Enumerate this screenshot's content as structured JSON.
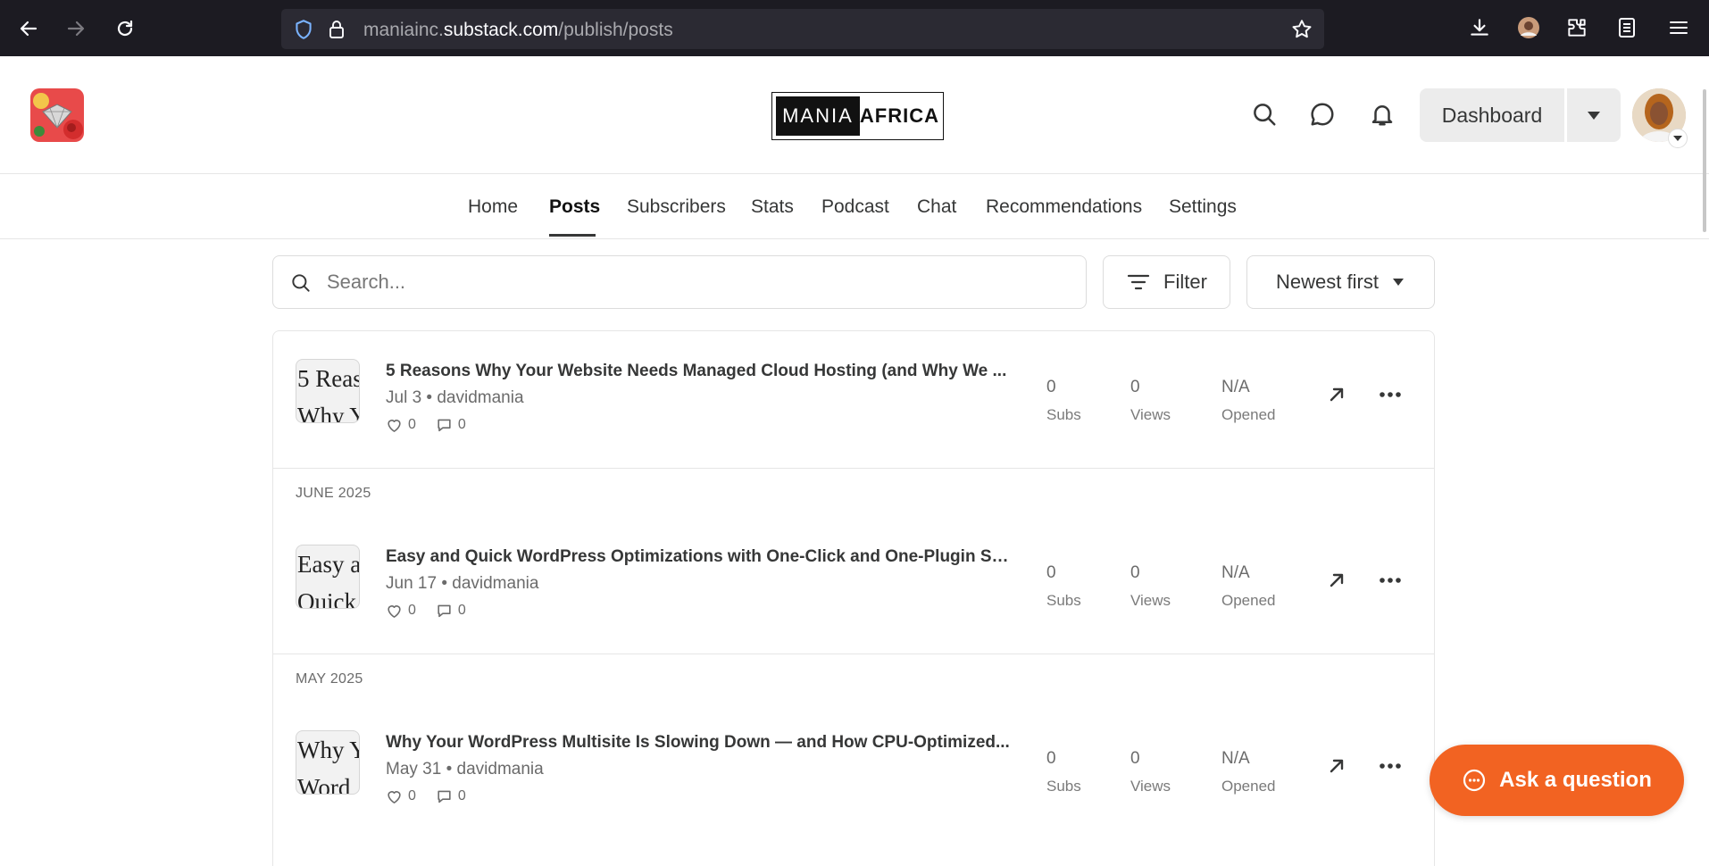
{
  "browser": {
    "url_prefix": "maniainc.",
    "url_host": "substack.com",
    "url_path": "/publish/posts"
  },
  "header": {
    "wordmark_left": "MANIA",
    "wordmark_right": "AFRICA",
    "dashboard_label": "Dashboard"
  },
  "tabs": [
    {
      "label": "Home"
    },
    {
      "label": "Posts"
    },
    {
      "label": "Subscribers"
    },
    {
      "label": "Stats"
    },
    {
      "label": "Podcast"
    },
    {
      "label": "Chat"
    },
    {
      "label": "Recommendations"
    },
    {
      "label": "Settings"
    }
  ],
  "toolbar": {
    "search_placeholder": "Search...",
    "filter_label": "Filter",
    "sort_label": "Newest first"
  },
  "posts": [
    {
      "thumb_line1": "5 Reas",
      "thumb_line2": "Why Y",
      "title": "5 Reasons Why Your Website Needs Managed Cloud Hosting (and Why We ...",
      "meta": "Jul 3 • davidmania",
      "likes": "0",
      "comments": "0",
      "subs": "0",
      "subs_label": "Subs",
      "views": "0",
      "views_label": "Views",
      "opened": "N/A",
      "opened_label": "Opened"
    },
    {
      "month": "JUNE 2025",
      "thumb_line1": "Easy a",
      "thumb_line2": "Quick",
      "title": "Easy and Quick WordPress Optimizations with One-Click and One-Plugin Sol...",
      "meta": "Jun 17 • davidmania",
      "likes": "0",
      "comments": "0",
      "subs": "0",
      "subs_label": "Subs",
      "views": "0",
      "views_label": "Views",
      "opened": "N/A",
      "opened_label": "Opened"
    },
    {
      "month": "MAY 2025",
      "thumb_line1": "Why Y",
      "thumb_line2": "Word",
      "title": "Why Your WordPress Multisite Is Slowing Down — and How CPU-Optimized...",
      "meta": "May 31 • davidmania",
      "likes": "0",
      "comments": "0",
      "subs": "0",
      "subs_label": "Subs",
      "views": "0",
      "views_label": "Views",
      "opened": "N/A",
      "opened_label": "Opened"
    }
  ],
  "ask": {
    "label": "Ask a question"
  },
  "colors": {
    "accent": "#f26322",
    "chrome_bg": "#1c1b22",
    "url_bg": "#2b2a33"
  }
}
